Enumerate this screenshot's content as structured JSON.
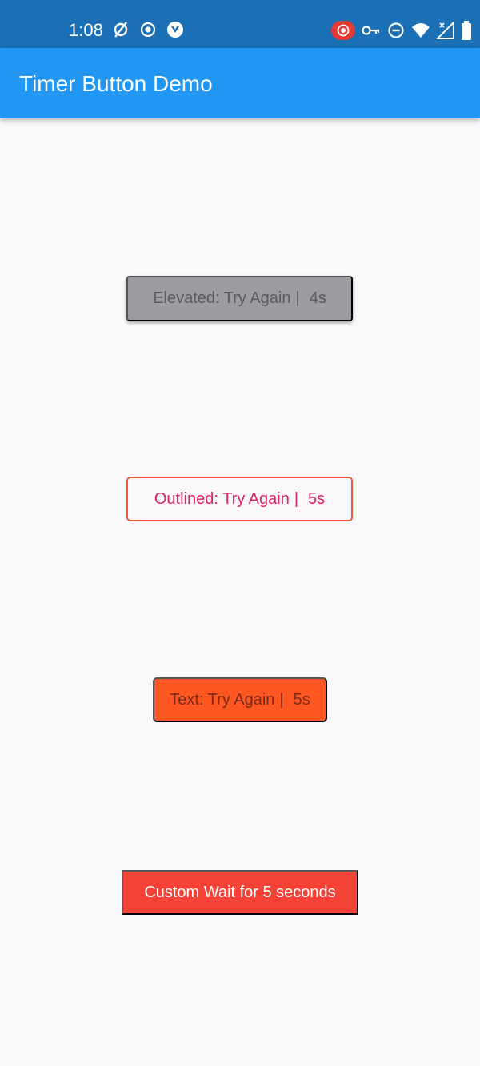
{
  "status_bar": {
    "time": "1:08",
    "left_icons": [
      "circle-slash-icon",
      "record-icon",
      "shield-app-icon"
    ],
    "right_icons": [
      "screen-record-icon",
      "vpn-key-icon",
      "do-not-disturb-icon",
      "wifi-icon",
      "no-signal-icon",
      "battery-icon"
    ]
  },
  "app_bar": {
    "title": "Timer Button Demo"
  },
  "buttons": {
    "elevated": {
      "label": "Elevated: Try Again",
      "separator": "|",
      "count": "4s"
    },
    "outlined": {
      "label": "Outlined: Try Again",
      "separator": "|",
      "count": "5s"
    },
    "text": {
      "label": "Text: Try Again",
      "separator": "|",
      "count": "5s"
    },
    "custom": {
      "label": "Custom Wait for 5 seconds"
    }
  },
  "colors": {
    "status_bar": "#1a6fb5",
    "app_bar": "#2196f3",
    "background": "#faf8fb",
    "elevated_disabled": "#9e9ca0",
    "outlined_text": "#e0245e",
    "outlined_border": "#f05a3a",
    "text_button_bg": "#ff5722",
    "custom_button_bg": "#f44336",
    "record_badge": "#e53935"
  }
}
